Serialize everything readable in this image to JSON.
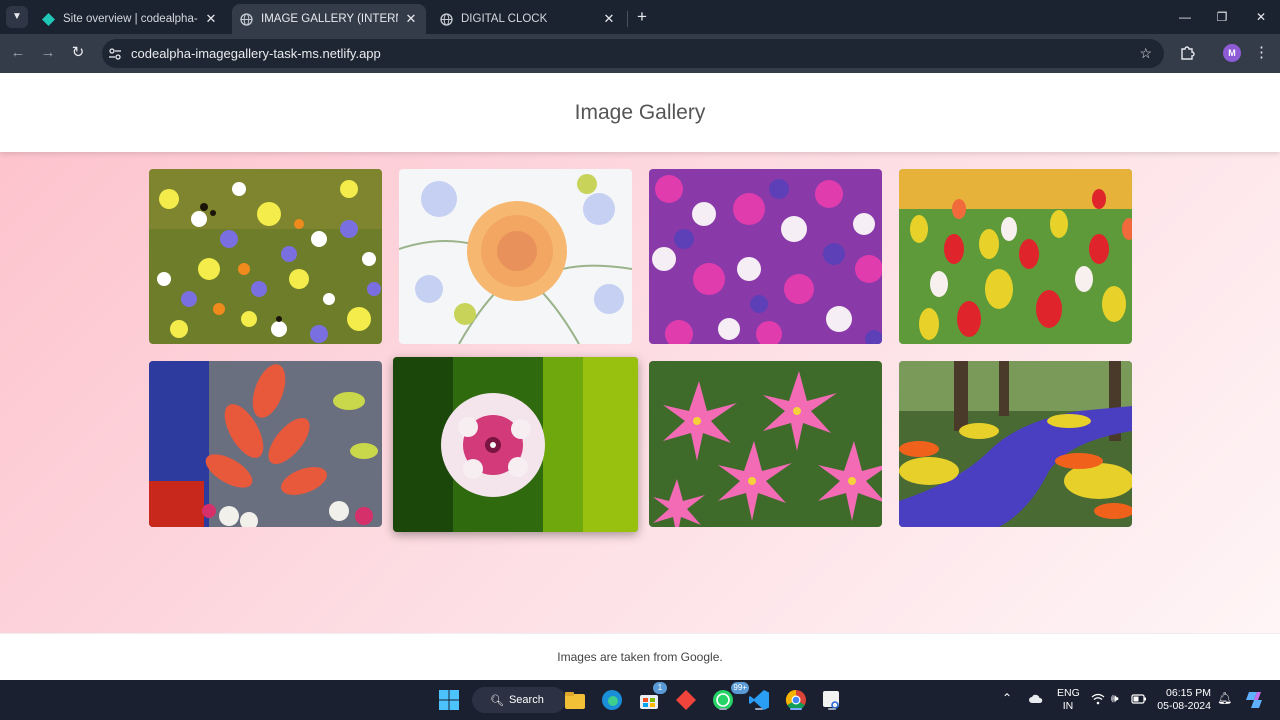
{
  "browser": {
    "tabs": [
      {
        "title": "Site overview | codealpha-imag",
        "active": false
      },
      {
        "title": "IMAGE GALLERY (INTERNSHIP T",
        "active": true
      },
      {
        "title": "DIGITAL CLOCK",
        "active": false
      }
    ],
    "new_tab_glyph": "+",
    "url": "codealpha-imagegallery-task-ms.netlify.app",
    "profile_initial": "M"
  },
  "page": {
    "title": "Image Gallery",
    "images": [
      {
        "subject": "wildflower meadow"
      },
      {
        "subject": "peach rose"
      },
      {
        "subject": "purple and white flower carpet"
      },
      {
        "subject": "tulip field"
      },
      {
        "subject": "red tulips in pot"
      },
      {
        "subject": "pink dianthus"
      },
      {
        "subject": "pink rain lilies"
      },
      {
        "subject": "flower garden path"
      }
    ],
    "footer": "Images are taken from Google."
  },
  "taskbar": {
    "search_label": "Search",
    "store_badge": "1",
    "whatsapp_badge": "99+",
    "language": [
      "ENG",
      "IN"
    ],
    "time": "06:15 PM",
    "date": "05-08-2024"
  },
  "colors": {
    "accent_profile": "#8e5bd6",
    "page_gradient_start": "#fdc1cb",
    "page_gradient_end": "#fff6f7"
  }
}
